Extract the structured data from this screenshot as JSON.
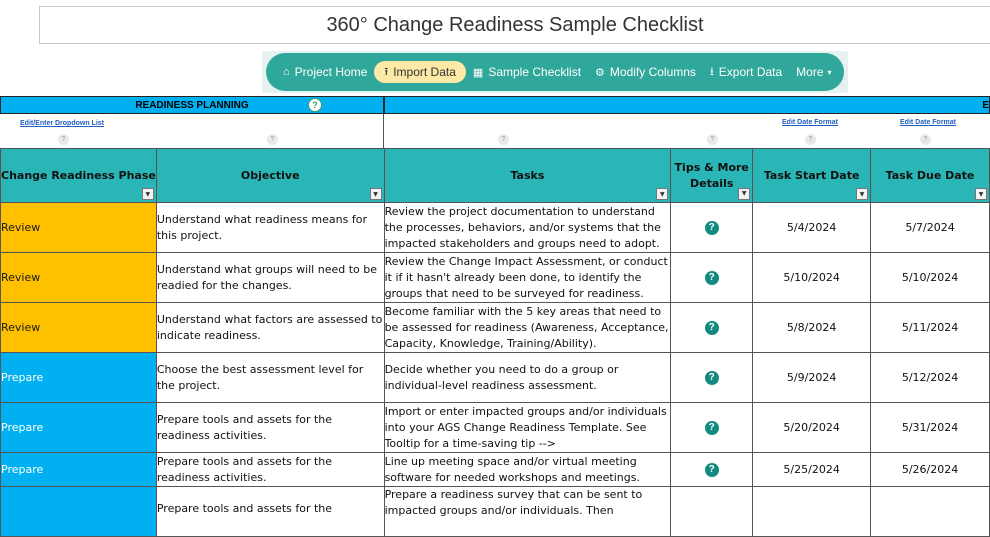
{
  "page": {
    "title": "360° Change Readiness Sample Checklist"
  },
  "nav": {
    "items": [
      {
        "label": "Project Home",
        "icon": "home-icon",
        "glyph": "⌂"
      },
      {
        "label": "Import Data",
        "icon": "import-icon",
        "glyph": "⭱"
      },
      {
        "label": "Sample Checklist",
        "icon": "grid-icon",
        "glyph": "▦"
      },
      {
        "label": "Modify Columns",
        "icon": "gear-icon",
        "glyph": "⚙"
      },
      {
        "label": "Export Data",
        "icon": "export-icon",
        "glyph": "⭳"
      },
      {
        "label": "More",
        "icon": "caret-down-icon",
        "glyph": "▾"
      }
    ],
    "active": "Import Data"
  },
  "bands": {
    "readiness_planning": "READINESS PLANNING",
    "right_band_fragment": "E"
  },
  "links": {
    "edit_dropdown": "Edit/Enter Dropdown List",
    "edit_date_format": "Edit Date Format"
  },
  "help_glyph": "?",
  "tip_glyph": "?",
  "dropdown_glyph": "▼",
  "table": {
    "headers": [
      "Change Readiness Phase",
      "Objective",
      "Tasks",
      "Tips & More Details",
      "Task Start Date",
      "Task Due Date"
    ],
    "rows": [
      {
        "phase": "Review",
        "objective": "Understand what readiness means for this project.",
        "task": "Review the project documentation to understand the processes, behaviors, and/or systems that the impacted stakeholders and groups need to adopt.",
        "start": "5/4/2024",
        "due": "5/7/2024"
      },
      {
        "phase": "Review",
        "objective": "Understand what groups will need to be readied for the changes.",
        "task": "Review the Change Impact Assessment, or conduct it if it hasn't already been done, to identify the groups that need to be surveyed for readiness.",
        "start": "5/10/2024",
        "due": "5/10/2024"
      },
      {
        "phase": "Review",
        "objective": "Understand what factors are assessed to indicate readiness.",
        "task": "Become familiar with the 5 key areas that need to be assessed for readiness (Awareness, Acceptance, Capacity, Knowledge, Training/Ability).",
        "start": "5/8/2024",
        "due": "5/11/2024"
      },
      {
        "phase": "Prepare",
        "objective": "Choose the best assessment level for the project.",
        "task": "Decide whether you need to do a group or individual-level readiness assessment.",
        "start": "5/9/2024",
        "due": "5/12/2024"
      },
      {
        "phase": "Prepare",
        "objective": "Prepare tools and assets for the readiness activities.",
        "task": "Import or enter impacted groups and/or individuals into your AGS Change Readiness Template. See Tooltip for a time-saving tip -->",
        "start": "5/20/2024",
        "due": "5/31/2024"
      },
      {
        "phase": "Prepare",
        "objective": "Prepare tools and assets for the readiness activities.",
        "task": "Line up meeting space and/or virtual meeting software for needed workshops and meetings.",
        "start": "5/25/2024",
        "due": "5/26/2024"
      },
      {
        "phase": "Prepare",
        "objective": "Prepare tools and assets for the",
        "task": "Prepare a readiness survey that can be sent to impacted groups and/or individuals. Then",
        "start": "",
        "due": ""
      }
    ]
  }
}
